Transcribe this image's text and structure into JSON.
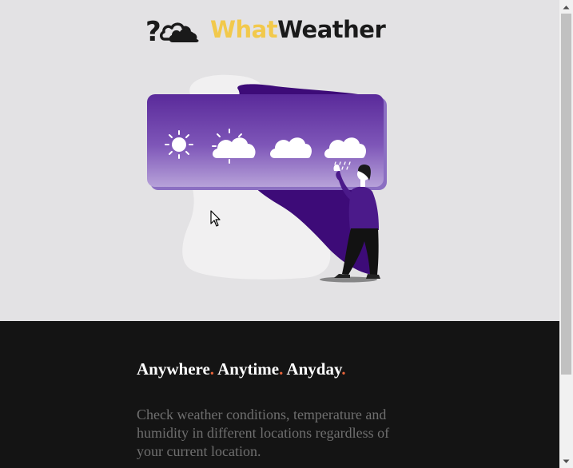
{
  "header": {
    "logo_icon": "question-cloud-icon",
    "logo_part1": "What",
    "logo_part2": "Weather",
    "colors": {
      "logo_part1": "#f2c94c",
      "logo_part2": "#1a1a1a"
    }
  },
  "hero": {
    "weather_icons": [
      "sun-icon",
      "sun-cloud-icon",
      "cloud-icon",
      "rain-cloud-icon"
    ],
    "colors": {
      "background": "#e3e2e4",
      "panel_top": "#5a2a9a",
      "panel_bottom": "#a98fd0",
      "person_shirt": "#4b1a8a"
    }
  },
  "intro": {
    "tagline": {
      "part1": "Anywhere",
      "dot1": ".",
      "part2": " Anytime",
      "dot2": ".",
      "part3": " Anyday",
      "dot3": "."
    },
    "description": "Check weather conditions, temperature and humidity in different locations regardless of your current location.",
    "colors": {
      "background": "#141414",
      "tagline": "#ffffff",
      "accent_dot": "#e8643a",
      "description": "#6f6f6f"
    }
  },
  "scrollbar": {
    "up_icon": "scroll-up-arrow-icon",
    "down_icon": "scroll-down-arrow-icon"
  }
}
